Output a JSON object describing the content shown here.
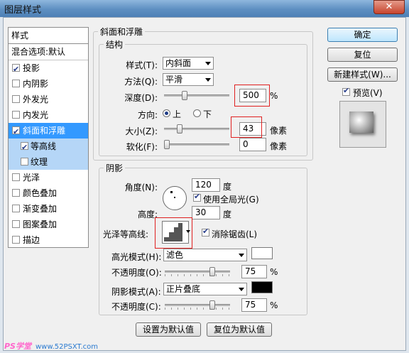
{
  "window": {
    "title": "图层样式",
    "close": "✕"
  },
  "styles_list": {
    "header": "样式",
    "blend_options": "混合选项:默认",
    "items": [
      {
        "label": "投影",
        "checked": true
      },
      {
        "label": "内阴影",
        "checked": false
      },
      {
        "label": "外发光",
        "checked": false
      },
      {
        "label": "内发光",
        "checked": false
      },
      {
        "label": "斜面和浮雕",
        "checked": true,
        "selected": true
      },
      {
        "label": "等高线",
        "checked": true,
        "sub": true
      },
      {
        "label": "纹理",
        "checked": false,
        "sub": true
      },
      {
        "label": "光泽",
        "checked": false
      },
      {
        "label": "颜色叠加",
        "checked": false
      },
      {
        "label": "渐变叠加",
        "checked": false
      },
      {
        "label": "图案叠加",
        "checked": false
      },
      {
        "label": "描边",
        "checked": false
      }
    ]
  },
  "bevel": {
    "group_title": "斜面和浮雕",
    "structure_title": "结构",
    "style_label": "样式(T):",
    "style_value": "内斜面",
    "technique_label": "方法(Q):",
    "technique_value": "平滑",
    "depth_label": "深度(D):",
    "depth_value": "500",
    "depth_unit": "%",
    "depth_slider": 0.3,
    "direction_label": "方向:",
    "dir_up": "上",
    "dir_down": "下",
    "size_label": "大小(Z):",
    "size_value": "43",
    "size_unit": "像素",
    "size_slider": 0.22,
    "soften_label": "软化(F):",
    "soften_value": "0",
    "soften_unit": "像素",
    "soften_slider": 0.0
  },
  "shading": {
    "title": "阴影",
    "angle_label": "角度(N):",
    "angle_value": "120",
    "angle_unit": "度",
    "global_light_label": "使用全局光(G)",
    "altitude_label": "高度:",
    "altitude_value": "30",
    "altitude_unit": "度",
    "gloss_contour_label": "光泽等高线:",
    "antialias_label": "消除锯齿(L)",
    "highlight_mode_label": "高光模式(H):",
    "highlight_mode_value": "滤色",
    "highlight_color": "#ffffff",
    "highlight_opacity_label": "不透明度(O):",
    "highlight_opacity_value": "75",
    "highlight_opacity_slider": 0.75,
    "shadow_mode_label": "阴影模式(A):",
    "shadow_mode_value": "正片叠底",
    "shadow_color": "#000000",
    "shadow_opacity_label": "不透明度(C):",
    "shadow_opacity_value": "75",
    "shadow_opacity_slider": 0.75,
    "percent": "%"
  },
  "buttons": {
    "set_default": "设置为默认值",
    "reset_default": "复位为默认值",
    "ok": "确定",
    "cancel": "复位",
    "new_style": "新建样式(W)...",
    "preview": "预览(V)"
  },
  "watermark": {
    "text": "PS学堂",
    "url": "www.52PSXT.com"
  }
}
